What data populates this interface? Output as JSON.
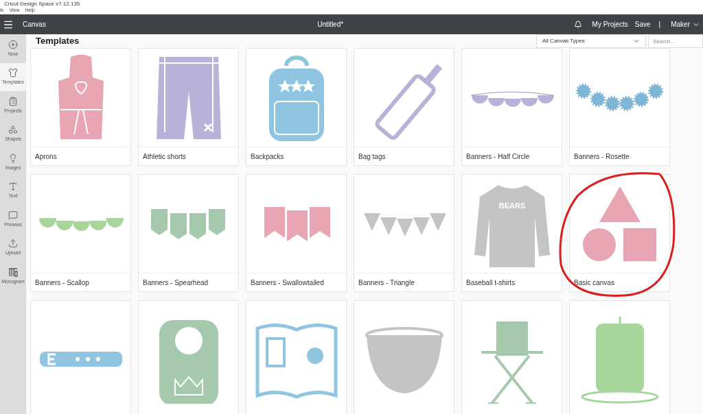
{
  "window": {
    "title": "Cricut Design Space v7.12.135"
  },
  "menu": [
    "le",
    "View",
    "Help"
  ],
  "header": {
    "section": "Canvas",
    "document": "Untitled*",
    "links": [
      "My Projects",
      "Save"
    ],
    "separator": "|",
    "machine": "Maker"
  },
  "sidebar": {
    "items": [
      {
        "label": "Now",
        "kind": "new",
        "selected": false
      },
      {
        "label": "Templates",
        "kind": "templates",
        "selected": true
      },
      {
        "label": "Projects",
        "kind": "projects",
        "selected": false
      },
      {
        "label": "Shapes",
        "kind": "shapes",
        "selected": false
      },
      {
        "label": "Images",
        "kind": "images",
        "selected": false
      },
      {
        "label": "Text",
        "kind": "text",
        "selected": false
      },
      {
        "label": "Phrases",
        "kind": "phrases",
        "selected": false
      },
      {
        "label": "Upload",
        "kind": "upload",
        "selected": false
      },
      {
        "label": "Monogram",
        "kind": "monogram",
        "selected": false
      }
    ]
  },
  "page": {
    "title": "Templates",
    "filter": "All Canvas Types",
    "search": {
      "placeholder": "Search..."
    }
  },
  "templates": [
    {
      "label": "Aprons",
      "kind": "apron"
    },
    {
      "label": "Athletic shorts",
      "kind": "shorts"
    },
    {
      "label": "Backpacks",
      "kind": "backpack"
    },
    {
      "label": "Bag tags",
      "kind": "bagtag"
    },
    {
      "label": "Banners - Half Circle",
      "kind": "halfcircle"
    },
    {
      "label": "Banners - Rosette",
      "kind": "rosette"
    },
    {
      "label": "Banners - Scallop",
      "kind": "scallop"
    },
    {
      "label": "Banners - Spearhead",
      "kind": "spearhead"
    },
    {
      "label": "Banners - Swallowtailed",
      "kind": "swallowtail"
    },
    {
      "label": "Banners - Triangle",
      "kind": "triangle"
    },
    {
      "label": "Baseball t-shirts",
      "kind": "tshirt",
      "print": "BEARS"
    },
    {
      "label": "Basic canvas",
      "kind": "basic",
      "circled": true
    },
    {
      "kind": "belt"
    },
    {
      "kind": "bib"
    },
    {
      "kind": "book"
    },
    {
      "kind": "bowl"
    },
    {
      "kind": "chair"
    },
    {
      "kind": "candle"
    }
  ]
}
